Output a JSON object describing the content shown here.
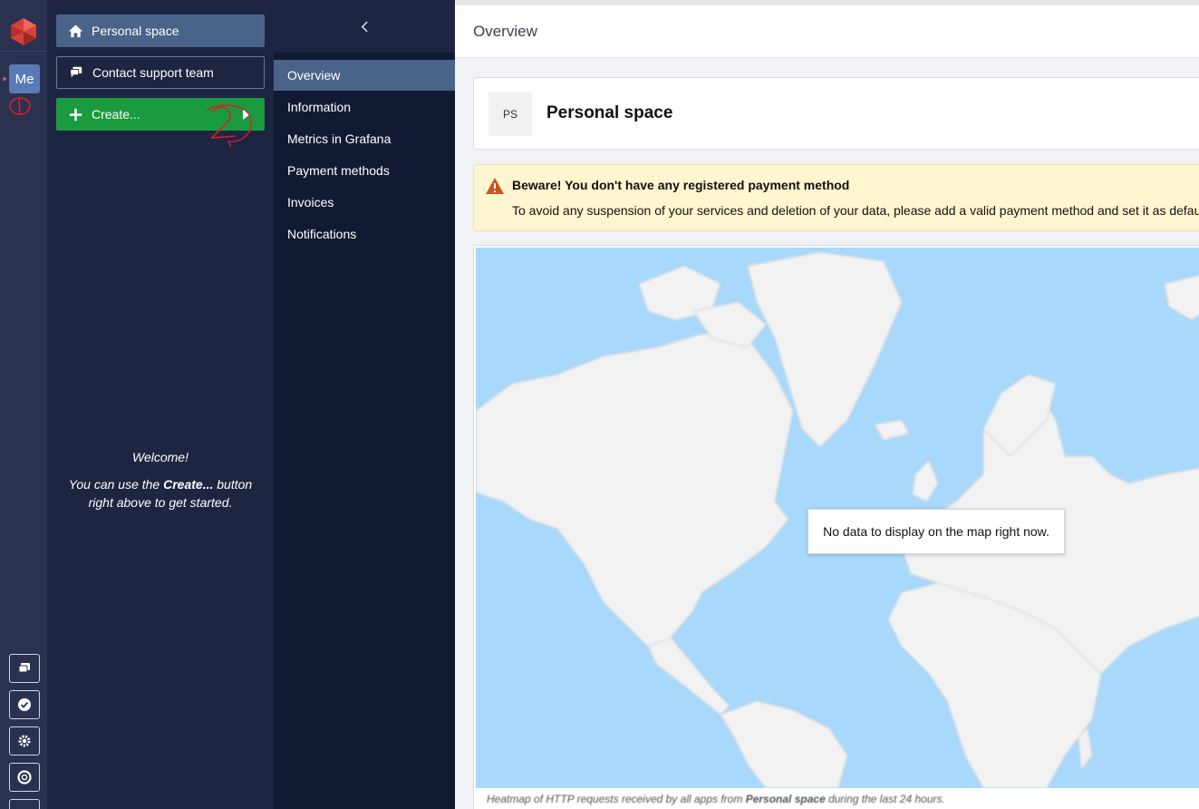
{
  "rail": {
    "me_label": "Me",
    "icons": [
      "chat-icon",
      "check-circle-icon",
      "gear-icon",
      "lifebuoy-icon"
    ]
  },
  "leftpanel": {
    "personal_space_label": "Personal space",
    "support_label": "Contact support team",
    "create_label": "Create...",
    "welcome_title": "Welcome!",
    "welcome_line_pre": "You can use the ",
    "welcome_line_bold": "Create...",
    "welcome_line_post": " button right above to get started."
  },
  "subnav": {
    "items": [
      {
        "label": "Overview",
        "active": true
      },
      {
        "label": "Information"
      },
      {
        "label": "Metrics in Grafana"
      },
      {
        "label": "Payment methods"
      },
      {
        "label": "Invoices"
      },
      {
        "label": "Notifications"
      }
    ]
  },
  "main": {
    "header_title": "Overview",
    "space_badge": "PS",
    "space_title": "Personal space",
    "warning_title": "Beware! You don't have any registered payment method",
    "warning_text": "To avoid any suspension of your services and deletion of your data, please add a valid payment method and set it as defau",
    "map_tooltip": "No data to display on the map right now.",
    "caption_pre": "Heatmap of HTTP requests received by all apps from ",
    "caption_bold": "Personal space",
    "caption_post": " during the last 24 hours."
  },
  "colors": {
    "rail_bg": "#2a3250",
    "panel_bg": "#1e2540",
    "subnav_bg": "#121a33",
    "active_bg": "#4a6388",
    "create_green": "#1b9b3f",
    "warning_bg": "#fff6cf",
    "map_water": "#a8d8fb",
    "map_land": "#f2f2f2"
  }
}
